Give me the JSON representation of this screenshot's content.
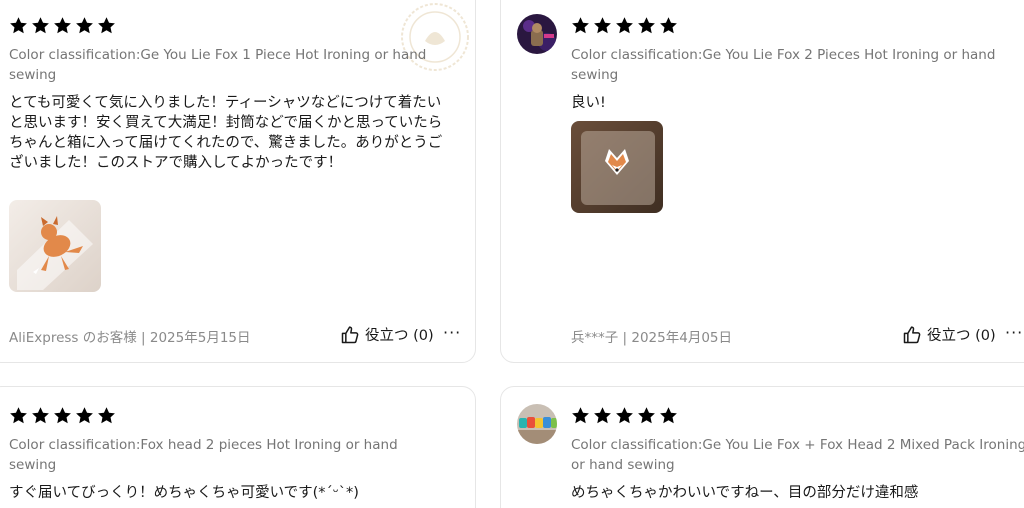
{
  "colors": {
    "star": "#fdb40a",
    "secondary_text": "#757575",
    "border": "#e6e6e6"
  },
  "reviews": [
    {
      "rating": 5,
      "classification": "Color classification:Ge You Lie Fox 1 Piece Hot Ironing or hand sewing",
      "text": "とても可愛くて気に入りました！ティーシャツなどにつけて着たいと思います！安く買えて大満足！封筒などで届くかと思っていたらちゃんと箱に入って届けてくれたので、驚きました。ありがとうございました！このストアで購入してよかったです！",
      "reviewer": "AliExpress のお客様 | 2025年5月15日",
      "helpful": "役立つ (0)",
      "more": "···"
    },
    {
      "rating": 5,
      "classification": "Color classification:Ge You Lie Fox 2 Pieces Hot Ironing or hand sewing",
      "text": "良い!",
      "reviewer": "兵***子 | 2025年4月05日",
      "helpful": "役立つ (0)",
      "more": "···"
    },
    {
      "rating": 5,
      "classification": "Color classification:Fox head 2 pieces Hot Ironing or hand sewing",
      "text": "すぐ届いてびっくり！めちゃくちゃ可愛いです(*ˊᵕˋ*)"
    },
    {
      "rating": 5,
      "classification": "Color classification:Ge You Lie Fox + Fox Head 2 Mixed Pack Ironing or hand sewing",
      "text": "めちゃくちゃかわいいですねー、目の部分だけ違和感"
    }
  ]
}
